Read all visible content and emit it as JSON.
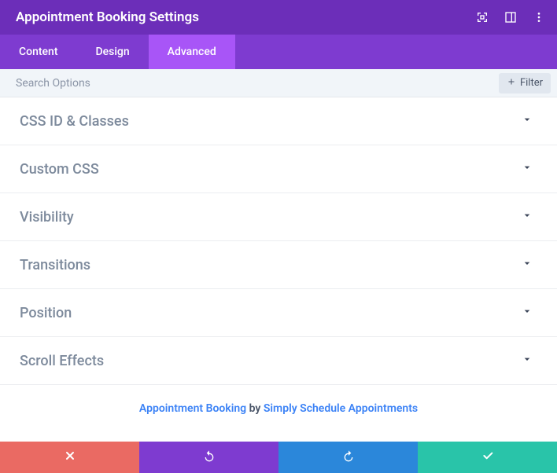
{
  "header": {
    "title": "Appointment Booking Settings"
  },
  "tabs": [
    {
      "label": "Content",
      "active": false
    },
    {
      "label": "Design",
      "active": false
    },
    {
      "label": "Advanced",
      "active": true
    }
  ],
  "search": {
    "placeholder": "Search Options",
    "filter_label": "Filter"
  },
  "sections": [
    {
      "label": "CSS ID & Classes"
    },
    {
      "label": "Custom CSS"
    },
    {
      "label": "Visibility"
    },
    {
      "label": "Transitions"
    },
    {
      "label": "Position"
    },
    {
      "label": "Scroll Effects"
    }
  ],
  "credit": {
    "link1": "Appointment Booking",
    "by": " by ",
    "link2": "Simply Schedule Appointments"
  }
}
